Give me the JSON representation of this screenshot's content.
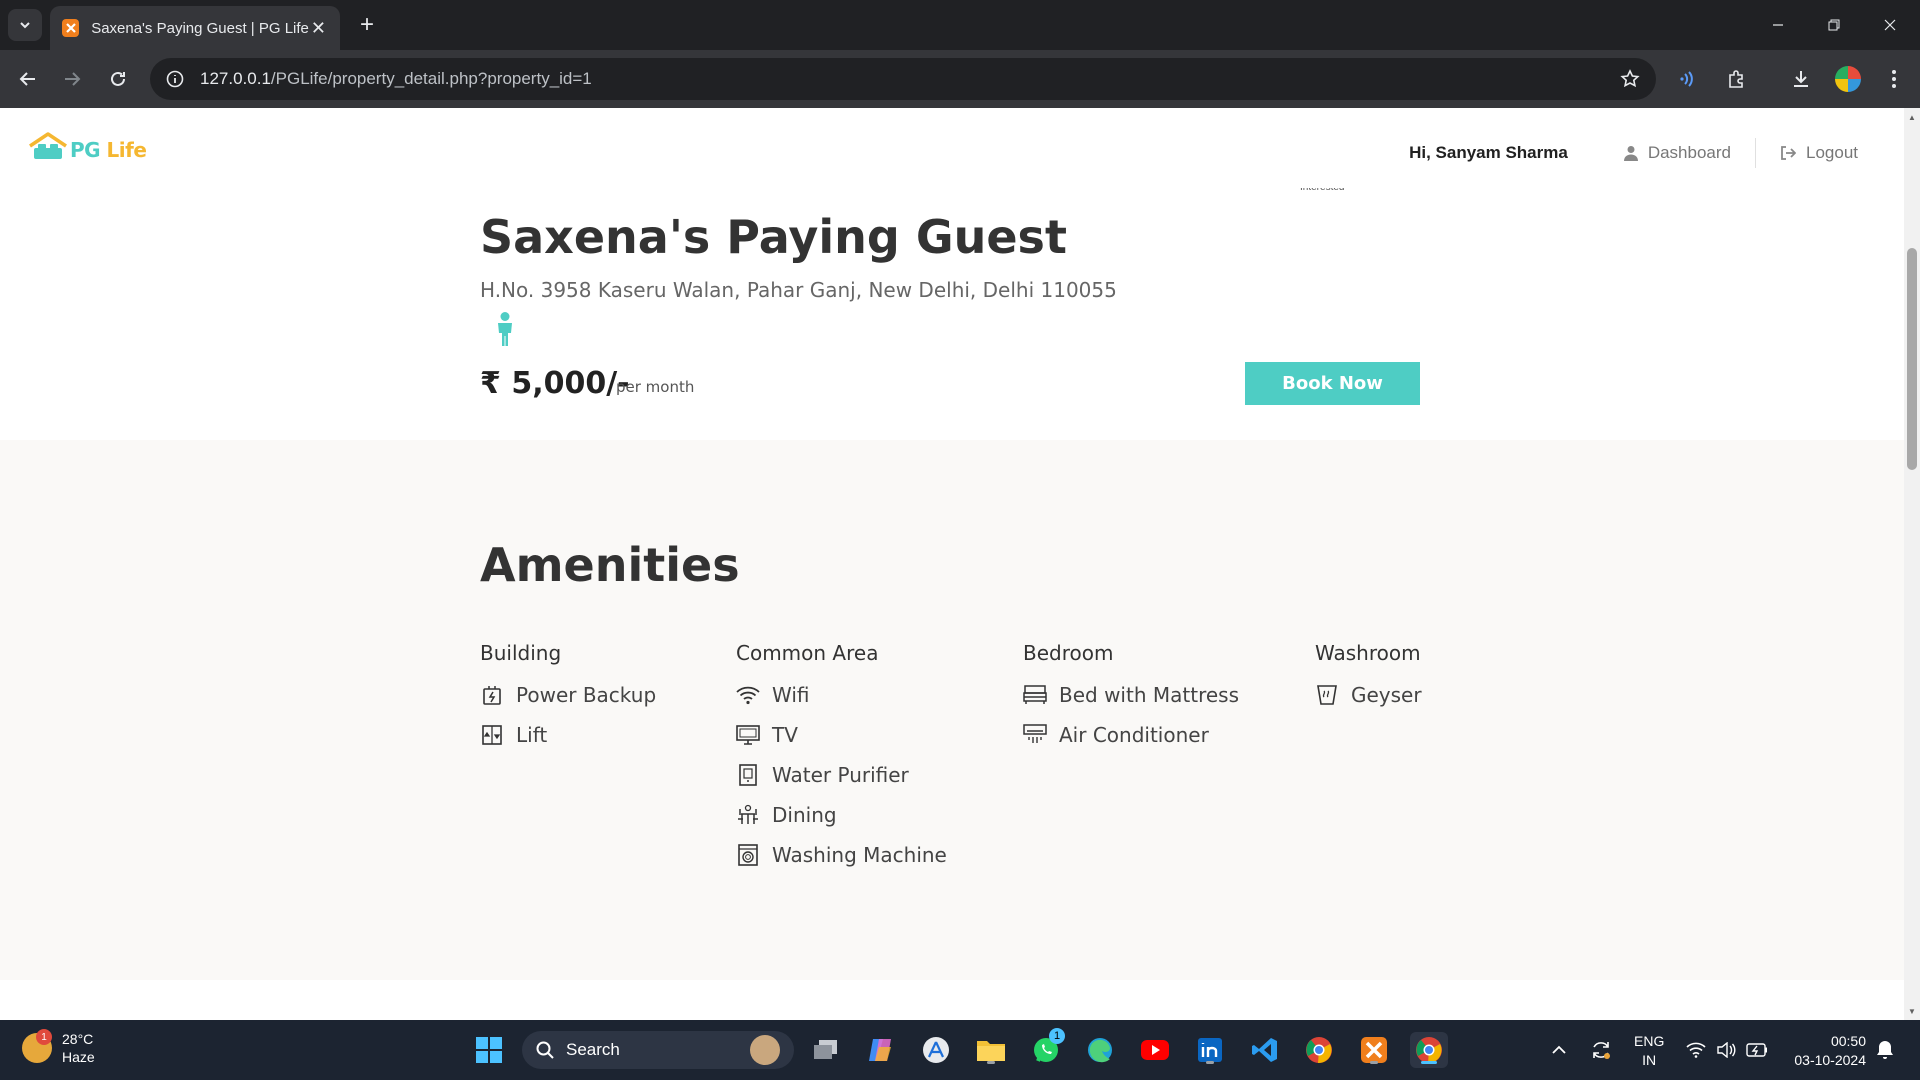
{
  "browser": {
    "tab_title": "Saxena's Paying Guest | PG Life",
    "tab_close": "✕",
    "new_tab": "+",
    "url_host": "127.0.0.1",
    "url_path": "/PGLife/property_detail.php?property_id=1"
  },
  "site": {
    "logo_pg": "PG",
    "logo_life": "Life",
    "greeting": "Hi, Sanyam Sharma",
    "dashboard_label": "Dashboard",
    "logout_label": "Logout"
  },
  "property": {
    "interested_clip": "Interested",
    "name": "Saxena's Paying Guest",
    "address": "H.No. 3958 Kaseru Walan, Pahar Ganj, New Delhi, Delhi 110055",
    "gender_icon": "male-icon",
    "price": "₹ 5,000/-",
    "price_unit": "per month",
    "book_label": "Book Now"
  },
  "amenities": {
    "title": "Amenities",
    "groups": [
      {
        "name": "Building",
        "items": [
          {
            "label": "Power Backup",
            "icon": "power-backup-icon"
          },
          {
            "label": "Lift",
            "icon": "lift-icon"
          }
        ]
      },
      {
        "name": "Common Area",
        "items": [
          {
            "label": "Wifi",
            "icon": "wifi-icon"
          },
          {
            "label": "TV",
            "icon": "tv-icon"
          },
          {
            "label": "Water Purifier",
            "icon": "water-purifier-icon"
          },
          {
            "label": "Dining",
            "icon": "dining-icon"
          },
          {
            "label": "Washing Machine",
            "icon": "washing-machine-icon"
          }
        ]
      },
      {
        "name": "Bedroom",
        "items": [
          {
            "label": "Bed with Mattress",
            "icon": "bed-icon"
          },
          {
            "label": "Air Conditioner",
            "icon": "air-conditioner-icon"
          }
        ]
      },
      {
        "name": "Washroom",
        "items": [
          {
            "label": "Geyser",
            "icon": "geyser-icon"
          }
        ]
      }
    ]
  },
  "taskbar": {
    "weather_temp": "28°C",
    "weather_desc": "Haze",
    "weather_badge": "1",
    "search_label": "Search",
    "whatsapp_badge": "1",
    "lang_top": "ENG",
    "lang_bottom": "IN",
    "time": "00:50",
    "date": "03-10-2024"
  },
  "colors": {
    "accent": "#4ecdc4",
    "logo_life": "#f5b731",
    "amenities_bg": "#faf9f7"
  }
}
